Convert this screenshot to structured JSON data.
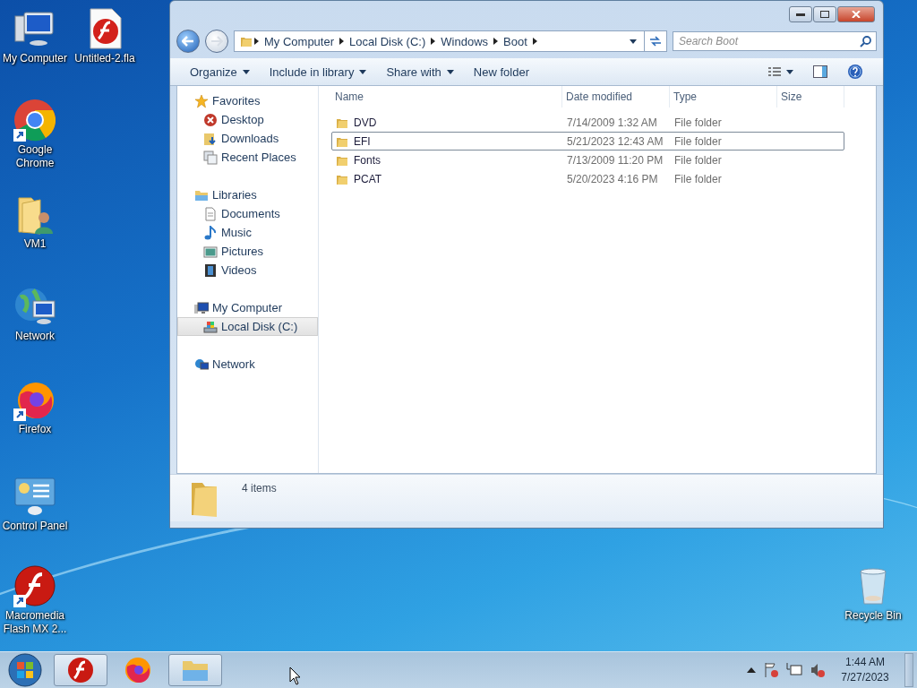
{
  "desktop_icons": [
    {
      "label": "My Computer",
      "kind": "computer"
    },
    {
      "label": "Untitled-2.fla",
      "kind": "fla"
    },
    {
      "label": "Google Chrome",
      "kind": "chrome"
    },
    {
      "label": "VM1",
      "kind": "user-folder"
    },
    {
      "label": "Network",
      "kind": "network"
    },
    {
      "label": "Firefox",
      "kind": "firefox"
    },
    {
      "label": "Control Panel",
      "kind": "control-panel"
    },
    {
      "label": "Macromedia Flash MX 2...",
      "kind": "flash"
    },
    {
      "label": "Recycle Bin",
      "kind": "recycle-bin"
    }
  ],
  "window": {
    "address": {
      "crumbs": [
        "My Computer",
        "Local Disk (C:)",
        "Windows",
        "Boot"
      ]
    },
    "search": {
      "placeholder": "Search Boot"
    },
    "toolbar": [
      {
        "label": "Organize",
        "has_menu": true
      },
      {
        "label": "Include in library",
        "has_menu": true
      },
      {
        "label": "Share with",
        "has_menu": true
      },
      {
        "label": "New folder",
        "has_menu": false
      }
    ],
    "nav": [
      {
        "label": "Favorites",
        "kind": "star",
        "selected": false,
        "children": [
          {
            "label": "Desktop",
            "kind": "desktop",
            "selected": false
          },
          {
            "label": "Downloads",
            "kind": "downloads",
            "selected": false
          },
          {
            "label": "Recent Places",
            "kind": "recent",
            "selected": false
          }
        ]
      },
      {
        "label": "Libraries",
        "kind": "library",
        "selected": false,
        "children": [
          {
            "label": "Documents",
            "kind": "documents",
            "selected": false
          },
          {
            "label": "Music",
            "kind": "music",
            "selected": false
          },
          {
            "label": "Pictures",
            "kind": "pictures",
            "selected": false
          },
          {
            "label": "Videos",
            "kind": "videos",
            "selected": false
          }
        ]
      },
      {
        "label": "My Computer",
        "kind": "computer",
        "selected": false,
        "children": [
          {
            "label": "Local Disk (C:)",
            "kind": "disk",
            "selected": true
          }
        ]
      },
      {
        "label": "Network",
        "kind": "network",
        "selected": false
      }
    ],
    "columns": [
      "Name",
      "Date modified",
      "Type",
      "Size"
    ],
    "rows": [
      {
        "name": "DVD",
        "date": "7/14/2009 1:32 AM",
        "type": "File folder",
        "focused": false
      },
      {
        "name": "EFI",
        "date": "5/21/2023 12:43 AM",
        "type": "File folder",
        "focused": true
      },
      {
        "name": "Fonts",
        "date": "7/13/2009 11:20 PM",
        "type": "File folder",
        "focused": false
      },
      {
        "name": "PCAT",
        "date": "5/20/2023 4:16 PM",
        "type": "File folder",
        "focused": false
      }
    ],
    "details": {
      "count": "4 items"
    }
  },
  "taskbar": {
    "buttons": [
      {
        "kind": "flash",
        "running": true
      },
      {
        "kind": "firefox",
        "running": false
      },
      {
        "kind": "explorer",
        "running": true
      }
    ],
    "clock": {
      "time": "1:44 AM",
      "date": "7/27/2023"
    }
  }
}
